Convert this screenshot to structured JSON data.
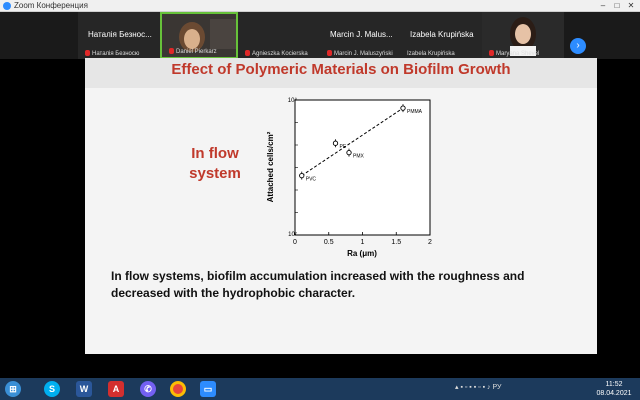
{
  "window": {
    "title": "Zoom Конференция"
  },
  "gallery": {
    "participants": [
      {
        "name": "Наталія Безнос...",
        "label": "Наталія Безносю"
      },
      {
        "name": "",
        "label": "Daniel Pierkarz"
      },
      {
        "name": "",
        "label": "Agnieszka Kocierska"
      },
      {
        "name": "Marcin J. Malus...",
        "label": "Marcin J. Maluszyński"
      },
      {
        "name": "Izabela Krupińska",
        "label": "Izabela Krupińska"
      },
      {
        "name": "",
        "label": "Maryana Shevel"
      }
    ],
    "next_icon": "chevron-right-icon"
  },
  "slide": {
    "title": "Effect of Polymeric Materials on Biofilm Growth",
    "subtitle": "In flow system",
    "body": "In flow systems, biofilm accumulation increased with the roughness and decreased with the hydrophobic character."
  },
  "chart_data": {
    "type": "scatter",
    "title": "",
    "xlabel": "Ra (μm)",
    "ylabel": "Attached cells/cm²",
    "xlim": [
      0,
      2
    ],
    "ylim": [
      0,
      1
    ],
    "x_ticks": [
      "0",
      "0.5",
      "1",
      "1.5",
      "2"
    ],
    "y_tick_top": "10⁸",
    "y_tick_bottom": "10⁷",
    "points": [
      {
        "label": "PVC",
        "x": 0.1,
        "y": 0.44
      },
      {
        "label": "PE",
        "x": 0.6,
        "y": 0.68
      },
      {
        "label": "PMX",
        "x": 0.8,
        "y": 0.61
      },
      {
        "label": "PMMA",
        "x": 1.6,
        "y": 0.94
      }
    ],
    "trendline": {
      "x": [
        0.1,
        1.6
      ],
      "y": [
        0.44,
        0.94
      ],
      "style": "dashed"
    }
  },
  "taskbar": {
    "apps": [
      "start-icon",
      "skype-icon",
      "word-icon",
      "pdf-icon",
      "viber-icon",
      "chrome-icon",
      "zoom-icon"
    ],
    "tray": "РУ",
    "clock": "11:52",
    "date": "08.04.2021"
  }
}
